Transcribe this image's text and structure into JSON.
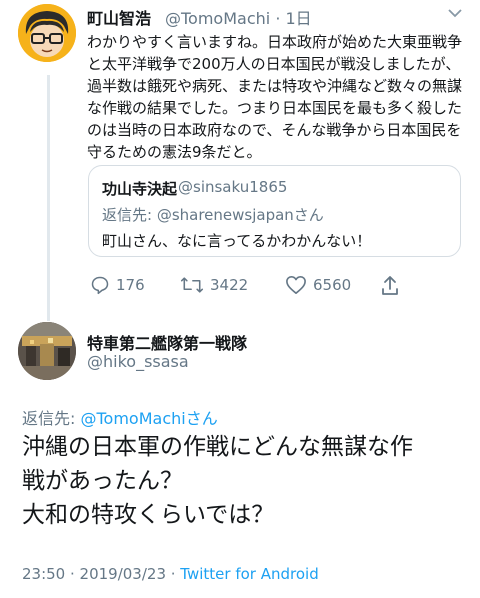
{
  "tweet": {
    "author_name": "町山智浩",
    "author_handle": "@TomoMachi",
    "time": "1日",
    "text": "わかりやすく言いますね。日本政府が始めた大東亜戦争と太平洋戦争で200万人の日本国民が戦没しましたが、過半数は餓死や病死、または特攻や沖縄など数々の無謀な作戦の結果でした。つまり日本国民を最も多く殺したのは当時の日本政府なので、そんな戦争から日本国民を守るための憲法9条だと。",
    "quoted": {
      "author_name": "功山寺決起",
      "author_handle": "@sinsaku1865",
      "reply_prefix": "返信先: ",
      "reply_to": "@sharenewsjapanさん",
      "text": "町山さん、なに言ってるかわかんない！"
    },
    "actions": {
      "replies": "176",
      "retweets": "3422",
      "likes": "6560"
    }
  },
  "reply": {
    "author_name": "特車第二艦隊第一戦隊",
    "author_handle": "@hiko_ssasa",
    "reply_prefix": "返信先: ",
    "reply_to": "@TomoMachiさん",
    "text_line1": "沖縄の日本軍の作戦にどんな無謀な作",
    "text_line2": "戦があったん？",
    "text_line3": "大和の特攻くらいでは？",
    "timestamp": "23:50 · 2019/03/23 · ",
    "source": "Twitter for Android"
  },
  "icons": {
    "reply": "reply-icon",
    "retweet": "retweet-icon",
    "like": "heart-icon",
    "share": "share-icon",
    "menu": "chevron-down-icon"
  },
  "colors": {
    "accent": "#1da1f2",
    "muted": "#657786"
  }
}
